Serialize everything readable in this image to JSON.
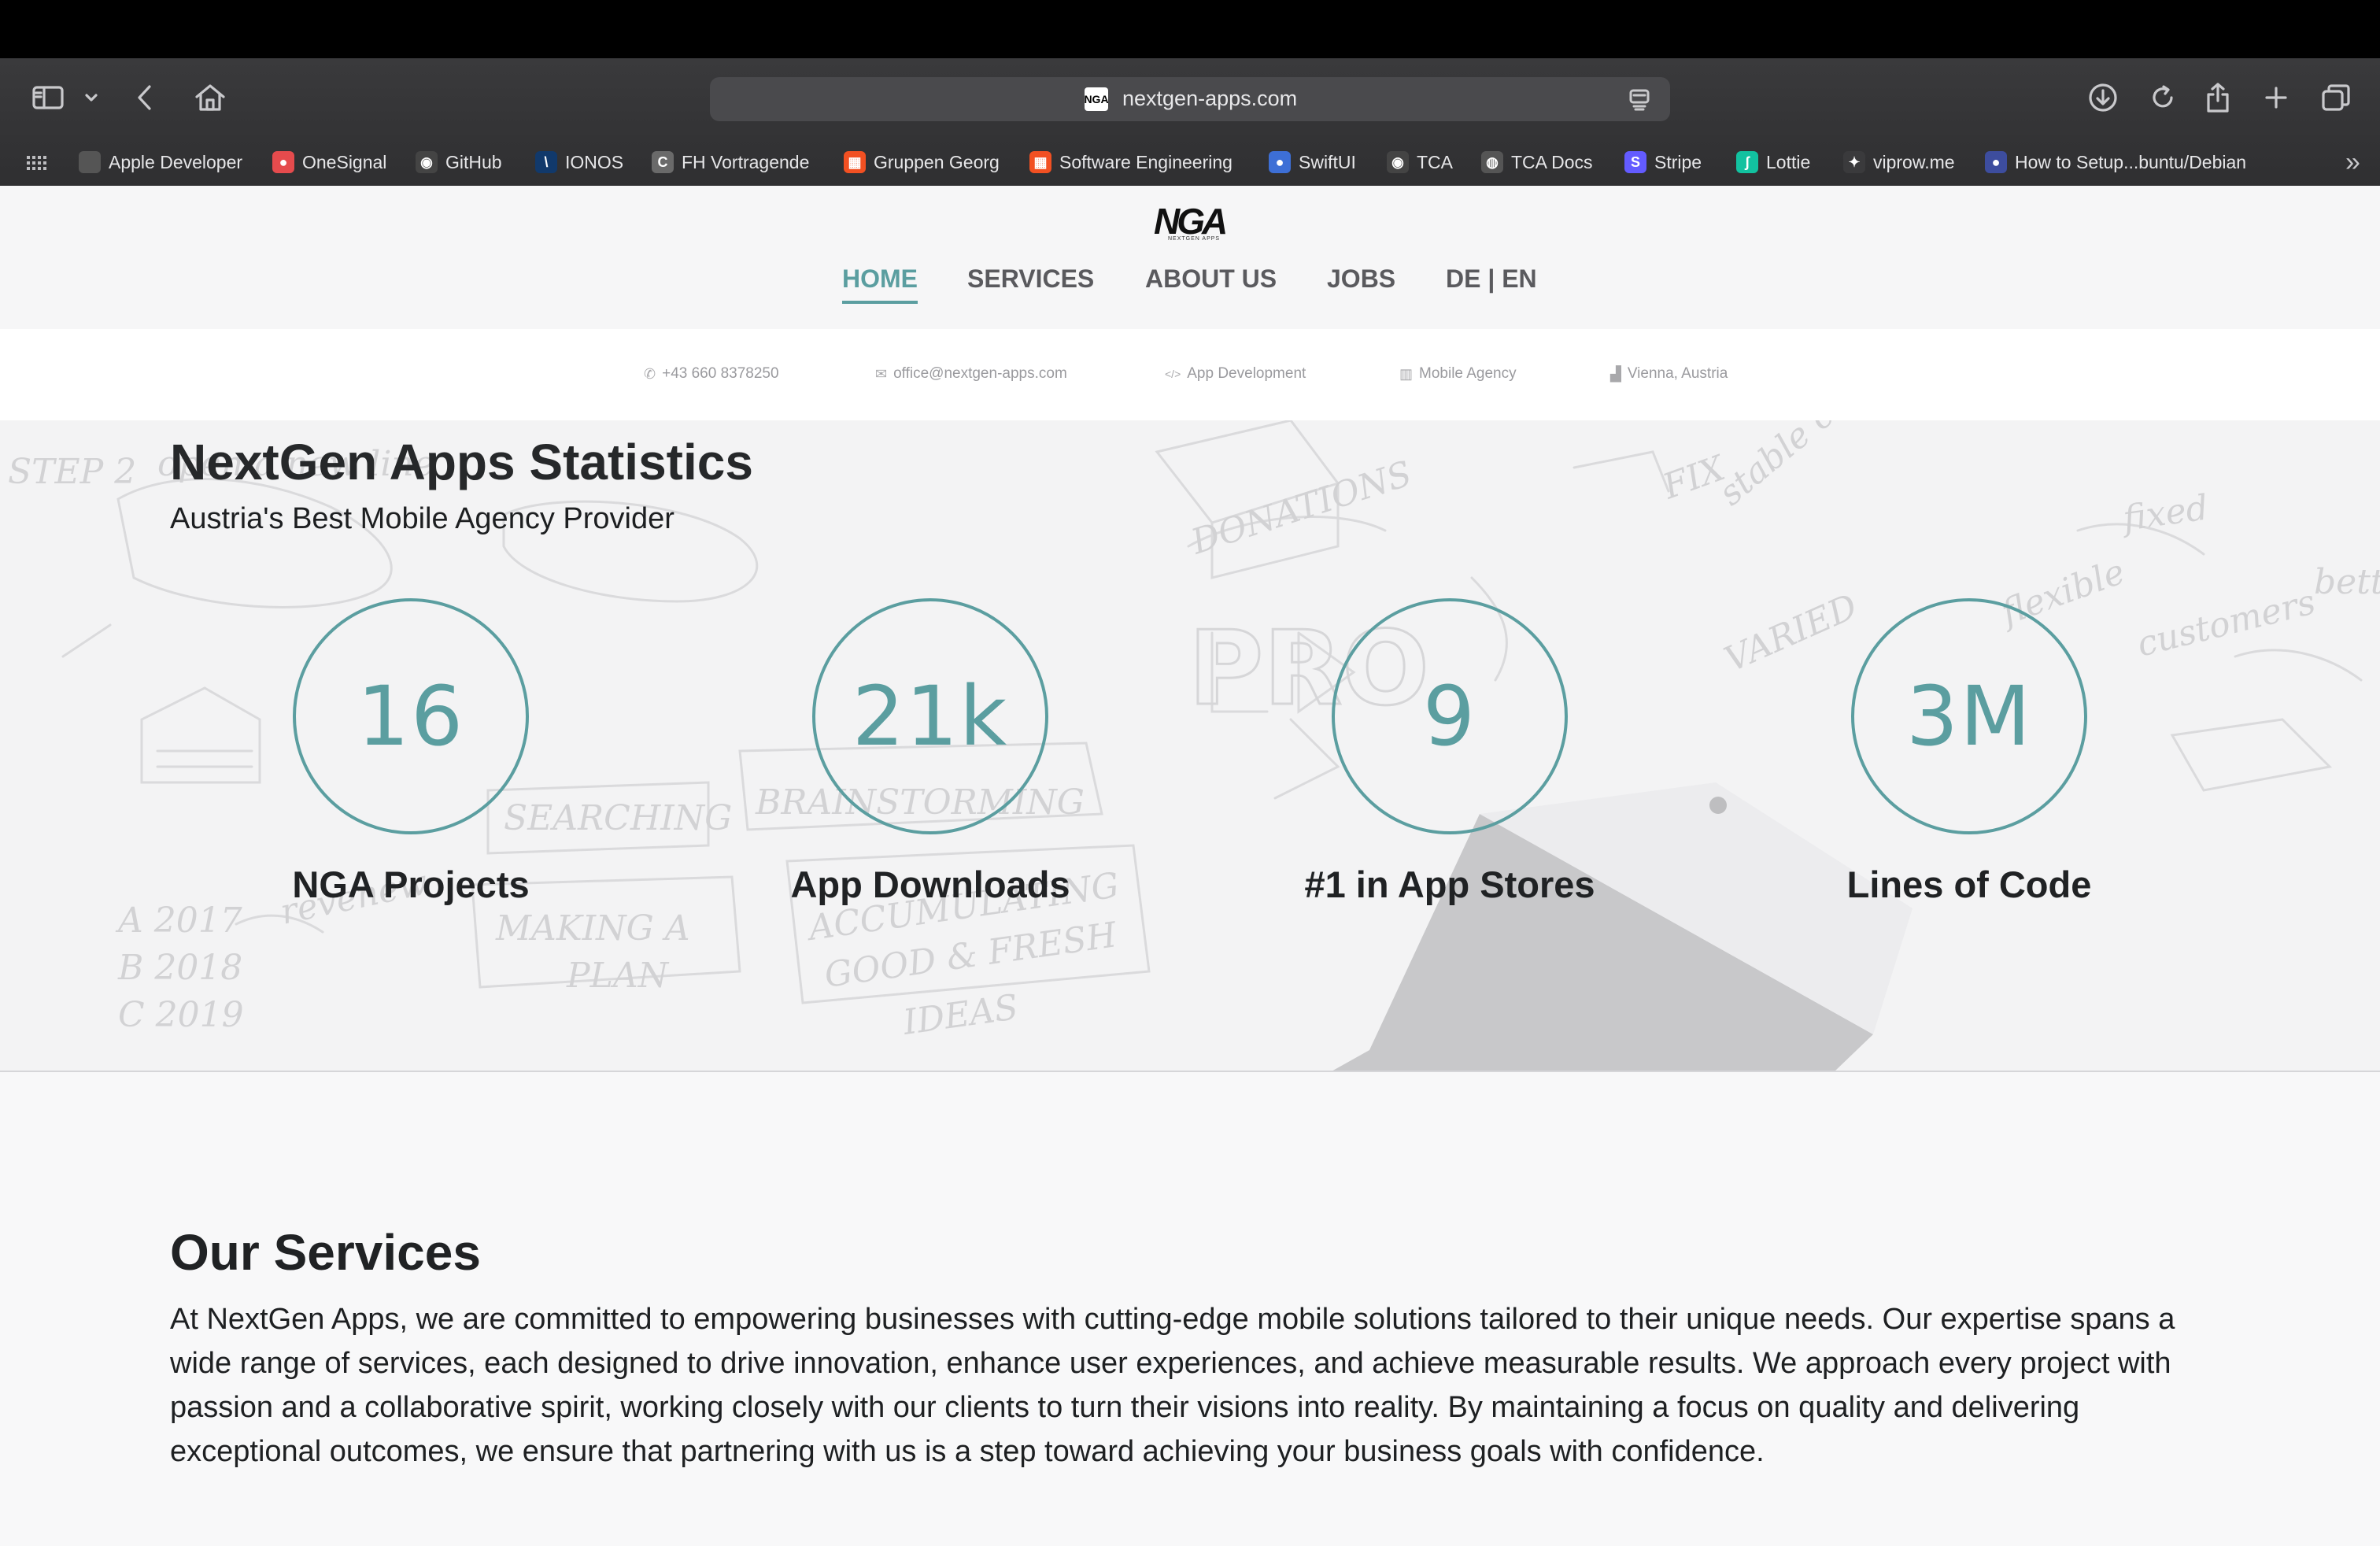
{
  "browser": {
    "url": "nextgen-apps.com",
    "url_favicon": "NGA",
    "icons": [
      "sidebar-icon",
      "chevron-down-icon",
      "back-icon",
      "home-icon",
      "reader-icon",
      "download-icon",
      "reload-icon",
      "share-icon",
      "plus-icon",
      "tabs-icon"
    ],
    "bookmarks": [
      {
        "label": "Apple Developer",
        "icon": "apple-icon",
        "color": "#555555",
        "glyph": ""
      },
      {
        "label": "OneSignal",
        "icon": "onesignal-icon",
        "color": "#e54b4d",
        "glyph": "●"
      },
      {
        "label": "GitHub",
        "icon": "github-icon",
        "color": "#444444",
        "glyph": "◉"
      },
      {
        "label": "IONOS",
        "icon": "ionos-icon",
        "color": "#11396b",
        "glyph": "\\"
      },
      {
        "label": "FH Vortragende",
        "icon": "fh-icon",
        "color": "#6a6a6a",
        "glyph": "C"
      },
      {
        "label": "Gruppen Georg",
        "icon": "microsoft-icon",
        "color": "#f25022",
        "glyph": "▦"
      },
      {
        "label": "Software Engineering",
        "icon": "microsoft-icon",
        "color": "#f25022",
        "glyph": "▦"
      },
      {
        "label": "SwiftUI",
        "icon": "swiftui-icon",
        "color": "#3d6fd6",
        "glyph": "●"
      },
      {
        "label": "TCA",
        "icon": "github-icon",
        "color": "#444444",
        "glyph": "◉"
      },
      {
        "label": "TCA Docs",
        "icon": "globe-icon",
        "color": "#555555",
        "glyph": "◍"
      },
      {
        "label": "Stripe",
        "icon": "stripe-icon",
        "color": "#635bff",
        "glyph": "S"
      },
      {
        "label": "Lottie",
        "icon": "lottie-icon",
        "color": "#12c2a0",
        "glyph": "ʃ"
      },
      {
        "label": "viprow.me",
        "icon": "viprow-icon",
        "color": "#3a3a3c",
        "glyph": "✦"
      },
      {
        "label": "How to Setup...buntu/Debian",
        "icon": "howto-icon",
        "color": "#3d4d9e",
        "glyph": "●"
      }
    ],
    "overflow_label": "»"
  },
  "site": {
    "logo": "NGA",
    "logo_sub": "NEXTGEN APPS",
    "nav": [
      "HOME",
      "SERVICES",
      "ABOUT US",
      "JOBS",
      "DE | EN"
    ],
    "active_nav": "HOME",
    "info": [
      {
        "icon": "phone-icon",
        "glyph": "✆",
        "label": "+43 660 8378250"
      },
      {
        "icon": "mail-icon",
        "glyph": "✉",
        "label": "office@nextgen-apps.com"
      },
      {
        "icon": "code-icon",
        "glyph": "</>",
        "label": "App Development"
      },
      {
        "icon": "building-icon",
        "glyph": "▥",
        "label": "Mobile Agency"
      },
      {
        "icon": "chart-icon",
        "glyph": "▟",
        "label": "Vienna, Austria"
      }
    ]
  },
  "stats": {
    "title": "NextGen Apps Statistics",
    "subtitle": "Austria's Best Mobile Agency Provider",
    "items": [
      {
        "value": "16",
        "label": "NGA Projects"
      },
      {
        "value": "21k",
        "label": "App Downloads"
      },
      {
        "value": "9",
        "label": "#1 in App Stores"
      },
      {
        "value": "3M",
        "label": "Lines of Code"
      }
    ]
  },
  "services": {
    "title": "Our Services",
    "text": "At NextGen Apps, we are committed to empowering businesses with cutting-edge mobile solutions tailored to their unique needs. Our expertise spans a wide range of services, each designed to drive innovation, enhance user experiences, and achieve measurable results. We approach every project with passion and a collaborative spirit, working closely with our clients to turn their visions into reality. By maintaining a focus on quality and delivering exceptional outcomes, we ensure that partnering with us is a step toward achieving your business goals with confidence."
  },
  "colors": {
    "accent": "#5b9ea0",
    "chrome": "#353537",
    "page_bg": "#f8f8f9"
  }
}
